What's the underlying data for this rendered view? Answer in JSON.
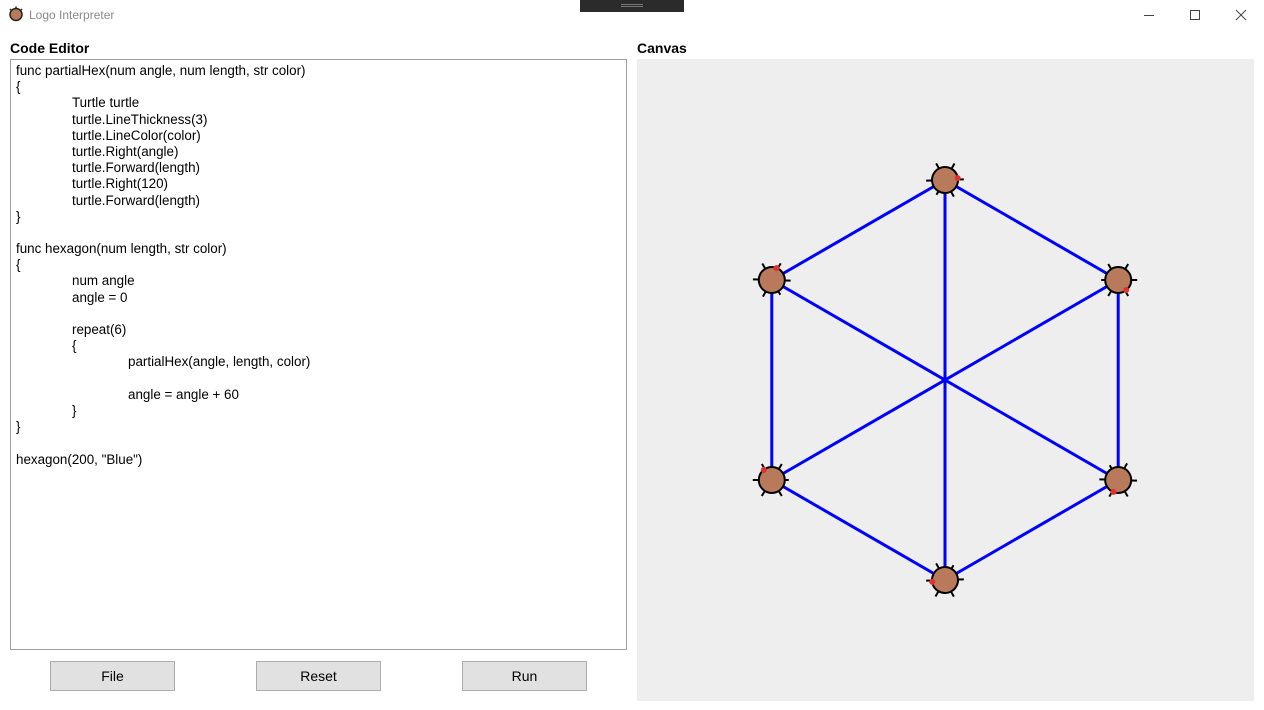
{
  "window": {
    "title": "Logo Interpreter",
    "controls": {
      "minimize": "minimize-icon",
      "maximize": "maximize-icon",
      "close": "close-icon"
    }
  },
  "editor": {
    "label": "Code Editor",
    "lines": [
      "func partialHex(num angle, num length, str color)",
      "{",
      "\t\tTurtle turtle",
      "\t\tturtle.LineThickness(3)",
      "\t\tturtle.LineColor(color)",
      "\t\tturtle.Right(angle)",
      "\t\tturtle.Forward(length)",
      "\t\tturtle.Right(120)",
      "\t\tturtle.Forward(length)",
      "}",
      "",
      "func hexagon(num length, str color)",
      "{",
      "\t\tnum angle",
      "\t\tangle = 0",
      "",
      "\t\trepeat(6)",
      "\t\t{",
      "\t\t\t\tpartialHex(angle, length, color)",
      "",
      "\t\t\t\tangle = angle + 60",
      "\t\t}",
      "}",
      "",
      "hexagon(200, \"Blue\")"
    ]
  },
  "buttons": {
    "file": "File",
    "reset": "Reset",
    "run": "Run"
  },
  "canvas": {
    "label": "Canvas",
    "background": "#eeeeee",
    "line_color": "#0000ff",
    "turtle_body_color": "#b87a5a",
    "turtle_count": 6
  }
}
